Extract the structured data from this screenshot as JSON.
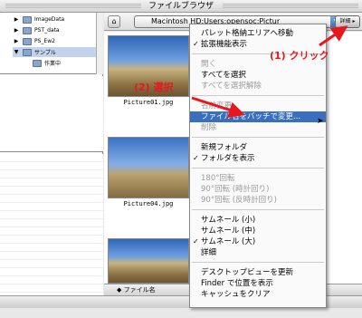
{
  "window": {
    "title": "ファイルブラウザ"
  },
  "tree": {
    "items": [
      {
        "label": "ImageData",
        "expanded": false
      },
      {
        "label": "PST_data",
        "expanded": false
      },
      {
        "label": "PS_Ew2",
        "expanded": false
      },
      {
        "label": "サンプル",
        "expanded": true,
        "selected": true
      },
      {
        "label": "作業中",
        "expanded": false
      }
    ]
  },
  "toolbar": {
    "path": "Macintosh HD:Users:opensoc:Pictur",
    "detail_label": "詳細"
  },
  "thumbnails": [
    {
      "label": "Picture01.jpg"
    },
    {
      "label": "Picture04.jpg"
    },
    {
      "label": ""
    }
  ],
  "status": {
    "sort_label": "ファイル名"
  },
  "menu": {
    "items": [
      {
        "label": "パレット格納エリアへ移動",
        "checked": false,
        "disabled": false
      },
      {
        "label": "拡張機能表示",
        "checked": true,
        "disabled": false
      },
      {
        "label": "開く",
        "checked": false,
        "disabled": true
      },
      {
        "label": "すべてを選択",
        "checked": false,
        "disabled": false
      },
      {
        "label": "すべてを選択解除",
        "checked": false,
        "disabled": true
      },
      {
        "label": "名前変更",
        "checked": false,
        "disabled": true
      },
      {
        "label": "ファイル名をバッチで変更...",
        "checked": false,
        "disabled": false,
        "highlight": true
      },
      {
        "label": "削除",
        "checked": false,
        "disabled": true
      },
      {
        "label": "新規フォルダ",
        "checked": false,
        "disabled": false
      },
      {
        "label": "フォルダを表示",
        "checked": true,
        "disabled": false
      },
      {
        "label": "180°回転",
        "checked": false,
        "disabled": true
      },
      {
        "label": "90°回転 (時計回り)",
        "checked": false,
        "disabled": true
      },
      {
        "label": "90°回転 (反時計回り)",
        "checked": false,
        "disabled": true
      },
      {
        "label": "サムネール (小)",
        "checked": false,
        "disabled": false
      },
      {
        "label": "サムネール (中)",
        "checked": false,
        "disabled": false
      },
      {
        "label": "サムネール (大)",
        "checked": true,
        "disabled": false
      },
      {
        "label": "詳細",
        "checked": false,
        "disabled": false
      },
      {
        "label": "デスクトップビューを更新",
        "checked": false,
        "disabled": false
      },
      {
        "label": "Finder で位置を表示",
        "checked": false,
        "disabled": false
      },
      {
        "label": "キャッシュをクリア",
        "checked": false,
        "disabled": false
      }
    ]
  },
  "annotations": {
    "step1": "(1) クリック",
    "step2": "(2) 選択"
  },
  "colors": {
    "highlight": "#3a6fc0",
    "annotation": "#e8171e"
  }
}
